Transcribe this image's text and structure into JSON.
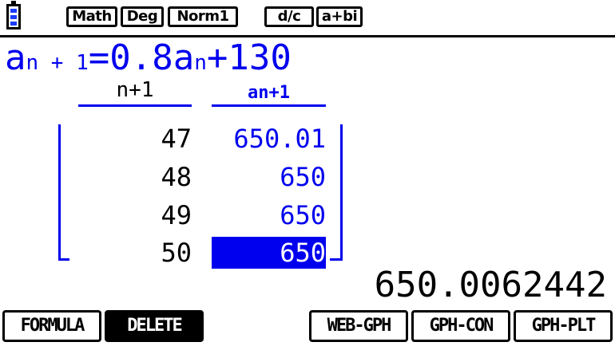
{
  "status_bar": {
    "battery_icon": "battery-icon",
    "modes": [
      "Math",
      "Deg",
      "Norm1",
      "d/c",
      "a+bi"
    ]
  },
  "formula": {
    "lhs_var": "a",
    "lhs_sub": "n + 1",
    "equals": "=",
    "coef": "0.8",
    "rhs_var": "a",
    "rhs_sub": "n",
    "rest": "+130"
  },
  "table": {
    "headers": [
      "n+1",
      "an+1"
    ],
    "rows": [
      {
        "n": "47",
        "a": "650.01"
      },
      {
        "n": "48",
        "a": "650"
      },
      {
        "n": "49",
        "a": "650"
      },
      {
        "n": "50",
        "a": "650"
      }
    ],
    "selected_row": 4
  },
  "result": "650.0062442",
  "function_keys": [
    "FORMULA",
    "DELETE",
    "WEB-GPH",
    "GPH-CON",
    "GPH-PLT"
  ],
  "colors": {
    "accent": "#0000ee",
    "text": "#000000",
    "background": "#ffffff"
  }
}
